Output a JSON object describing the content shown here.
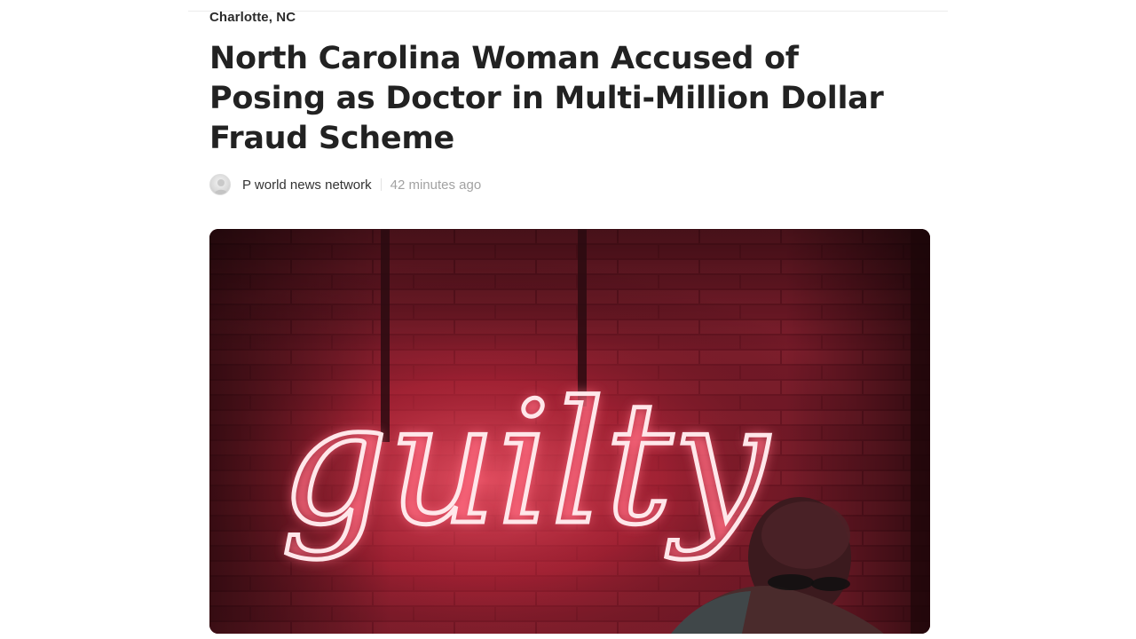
{
  "article": {
    "location": "Charlotte, NC",
    "headline": "North Carolina Woman Accused of Posing as Doctor in Multi-Million Dollar Fraud Scheme",
    "author": "P world news network",
    "published": "42 minutes ago"
  },
  "hero_image": {
    "neon_text": "guilty"
  },
  "colors": {
    "headline": "#222222",
    "timestamp": "#a2a2a2",
    "neon_glow": "#ff3a5c",
    "brick": "#8a1f2e"
  },
  "icons": {
    "avatar": "author-avatar-icon"
  }
}
